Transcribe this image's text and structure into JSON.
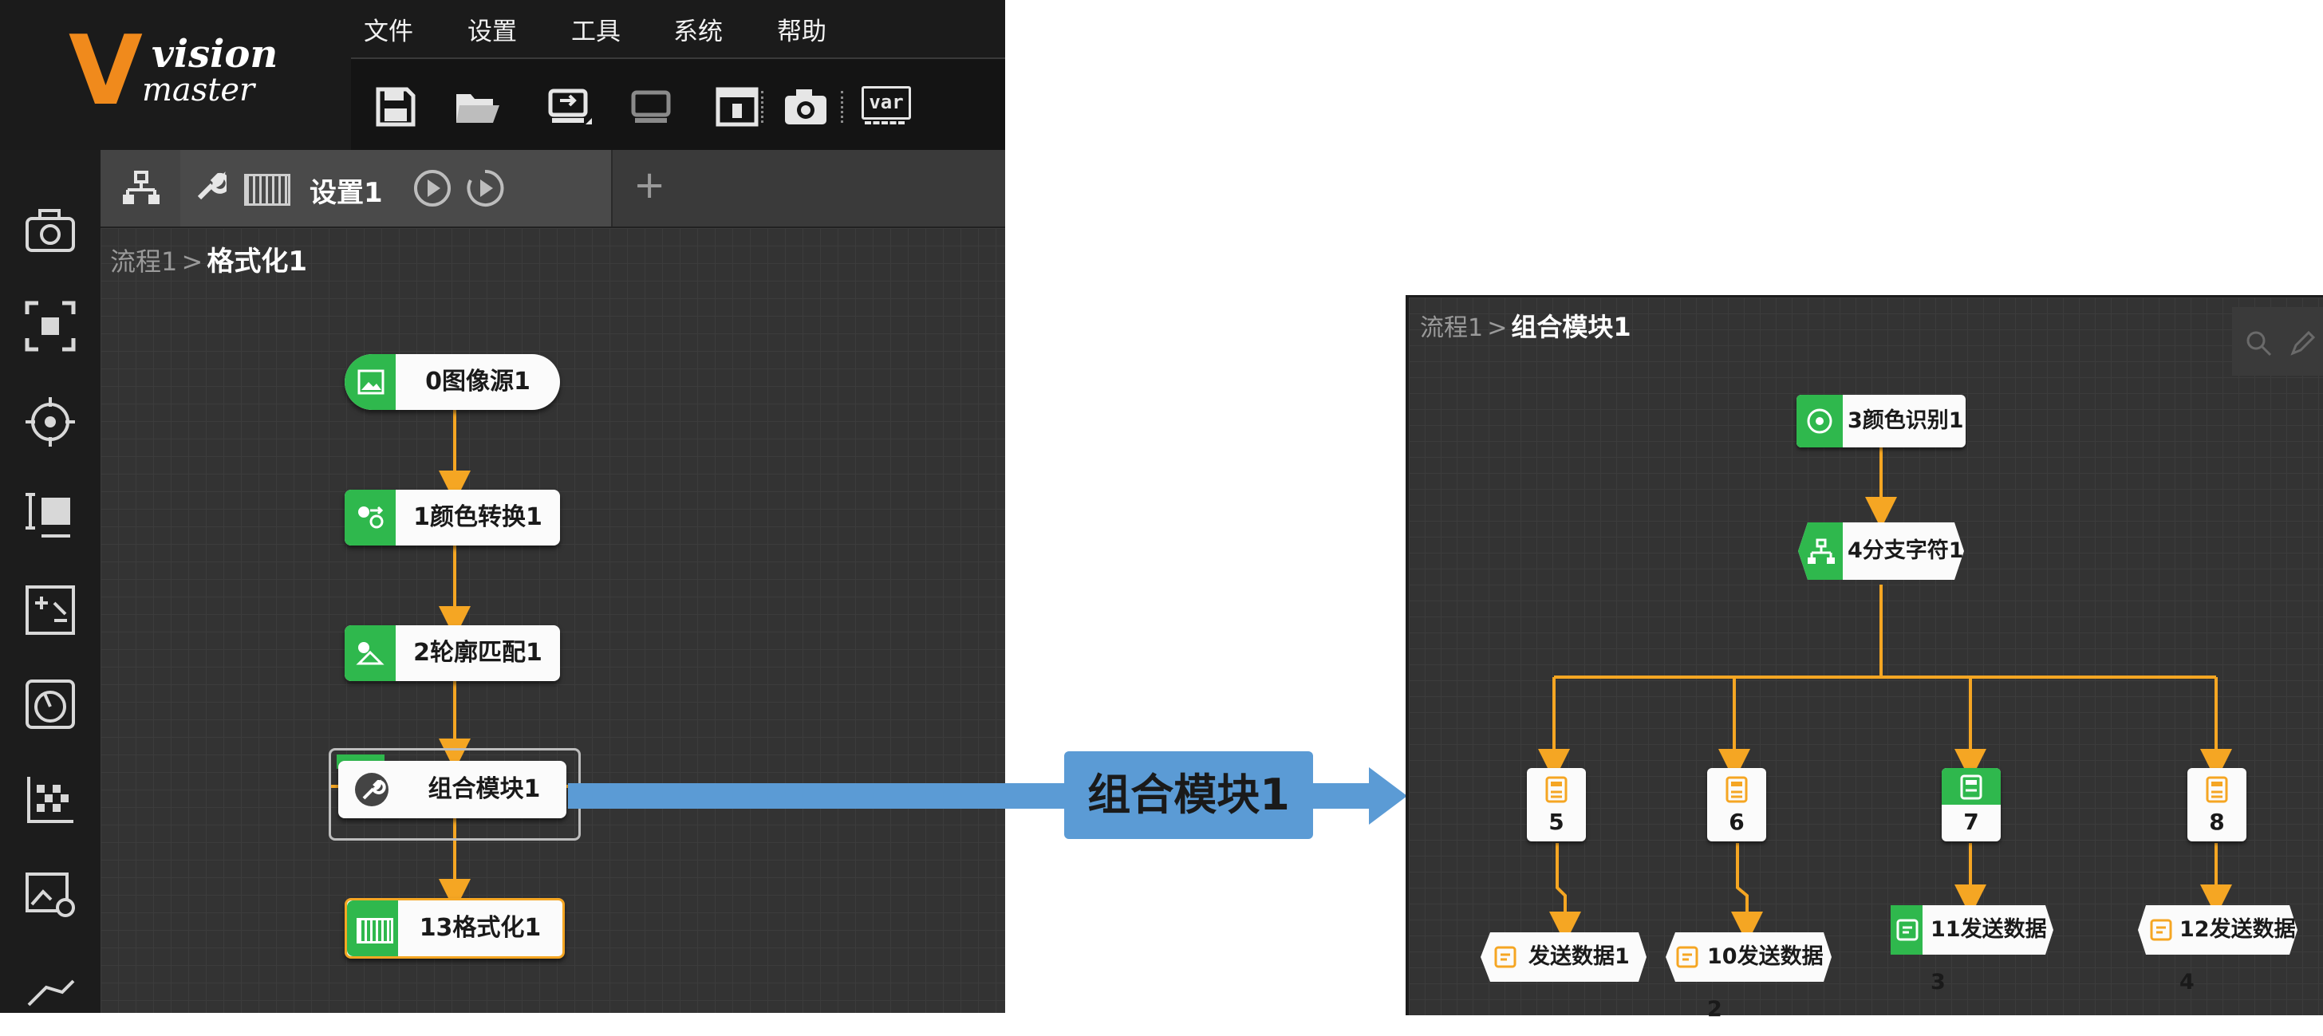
{
  "logo": {
    "mark": "V",
    "line1": "vision",
    "line2": "master"
  },
  "menu": [
    "文件",
    "设置",
    "工具",
    "系统",
    "帮助"
  ],
  "toolbar": {
    "var_label": "var"
  },
  "tabbar": {
    "active_tab_label": "设置1",
    "add_tab": "+"
  },
  "left_flow": {
    "breadcrumb": {
      "root": "流程1",
      "sep": ">",
      "current": "格式化1"
    },
    "nodes": [
      {
        "label": "0图像源1"
      },
      {
        "label": "1颜色转换1"
      },
      {
        "label": "2轮廓匹配1"
      },
      {
        "label": "组合模块1"
      },
      {
        "label": "13格式化1"
      }
    ]
  },
  "callout": {
    "label": "组合模块1"
  },
  "right_flow": {
    "breadcrumb": {
      "root": "流程1",
      "sep": ">",
      "current": "组合模块1"
    },
    "top_nodes": [
      {
        "label": "3颜色识别1"
      },
      {
        "label": "4分支字符1"
      }
    ],
    "branches": [
      {
        "num": "5",
        "send_label": "发送数据1"
      },
      {
        "num": "6",
        "send_label": "10发送数据2"
      },
      {
        "num": "7",
        "send_label": "11发送数据3"
      },
      {
        "num": "8",
        "send_label": "12发送数据4"
      }
    ]
  },
  "colors": {
    "accent_green": "#2fb84d",
    "link_orange": "#f5a623",
    "callout_blue": "#5b9bd5",
    "logo_orange": "#f08a1c"
  }
}
